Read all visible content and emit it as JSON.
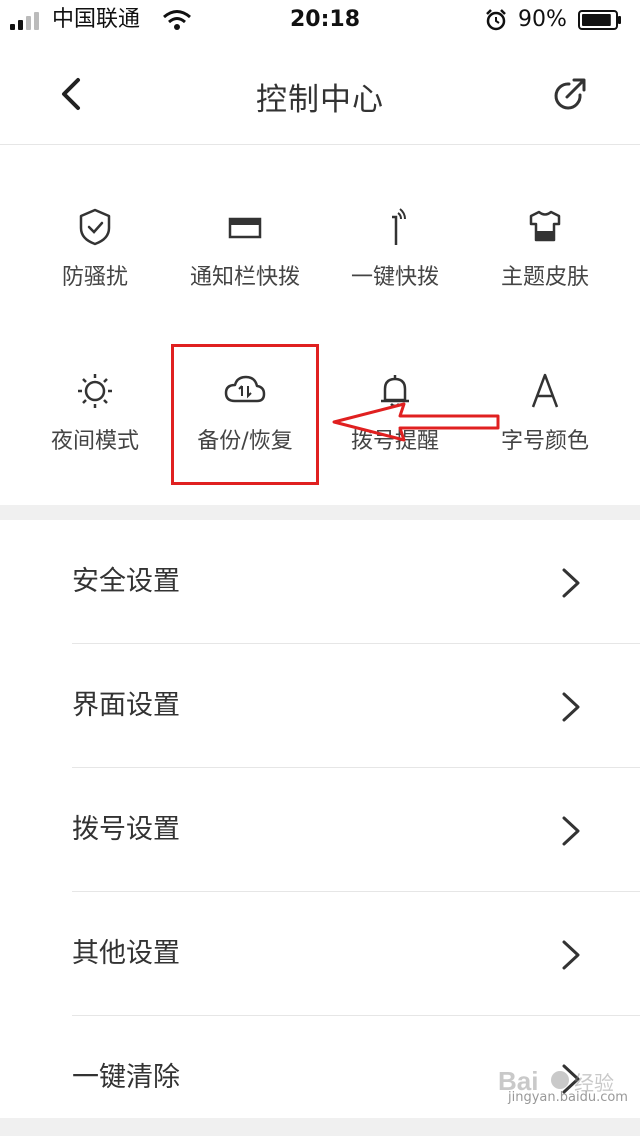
{
  "status_bar": {
    "carrier": "中国联通",
    "time": "20:18",
    "battery_percent": "90%",
    "battery_level": 0.9
  },
  "nav": {
    "title": "控制中心",
    "back_icon": "chevron-left-icon",
    "share_icon": "share-icon"
  },
  "grid": {
    "items": [
      {
        "label": "防骚扰",
        "icon": "shield-check-icon"
      },
      {
        "label": "通知栏快拨",
        "icon": "notification-bar-icon"
      },
      {
        "label": "一键快拨",
        "icon": "quick-dial-icon"
      },
      {
        "label": "主题皮肤",
        "icon": "tshirt-icon"
      },
      {
        "label": "夜间模式",
        "icon": "sun-icon"
      },
      {
        "label": "备份/恢复",
        "icon": "cloud-sync-icon"
      },
      {
        "label": "拨号提醒",
        "icon": "bell-icon"
      },
      {
        "label": "字号颜色",
        "icon": "font-icon"
      }
    ]
  },
  "list": {
    "items": [
      {
        "label": "安全设置"
      },
      {
        "label": "界面设置"
      },
      {
        "label": "拨号设置"
      },
      {
        "label": "其他设置"
      },
      {
        "label": "一键清除"
      }
    ]
  },
  "annotation": {
    "highlight_color": "#e02020"
  },
  "watermark": {
    "text": "jingyan.baidu.com"
  },
  "colors": {
    "text": "#333333",
    "icon": "#333333",
    "separator": "#e6e6e6",
    "band": "#f0f0f0",
    "annotation": "#e02020"
  }
}
